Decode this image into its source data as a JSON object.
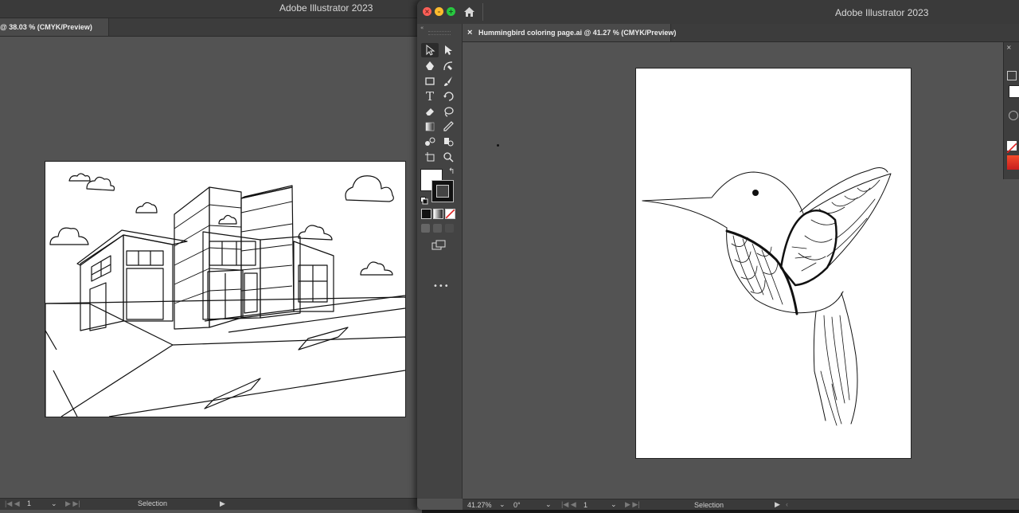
{
  "back_window": {
    "title": "Adobe Illustrator 2023",
    "tab_label": "@ 38.03 % (CMYK/Preview)",
    "status": {
      "artboard": "1",
      "mode": "Selection"
    }
  },
  "front_window": {
    "title": "Adobe Illustrator 2023",
    "tab_close": "×",
    "tab_label": "Hummingbird coloring page.ai @ 41.27 % (CMYK/Preview)",
    "status": {
      "zoom": "41.27%",
      "rotation": "0°",
      "artboard": "1",
      "mode": "Selection"
    },
    "more_tools": "•••"
  },
  "colors": {
    "ui_bg": "#535353",
    "titlebar": "#3a3a3a",
    "toolbar": "#434343",
    "close": "#ff5f57",
    "minimize": "#febc2e",
    "zoom": "#28c840"
  },
  "icons": [
    "home-icon",
    "selection-tool-icon",
    "direct-selection-tool-icon",
    "pen-tool-icon",
    "curvature-tool-icon",
    "rectangle-tool-icon",
    "paintbrush-tool-icon",
    "type-tool-icon",
    "rotate-tool-icon",
    "eraser-tool-icon",
    "lasso-tool-icon",
    "gradient-tool-icon",
    "eyedropper-tool-icon",
    "blend-tool-icon",
    "live-paint-icon",
    "artboard-tool-icon",
    "zoom-tool-icon",
    "swap-fill-stroke-icon",
    "default-fill-stroke-icon"
  ]
}
